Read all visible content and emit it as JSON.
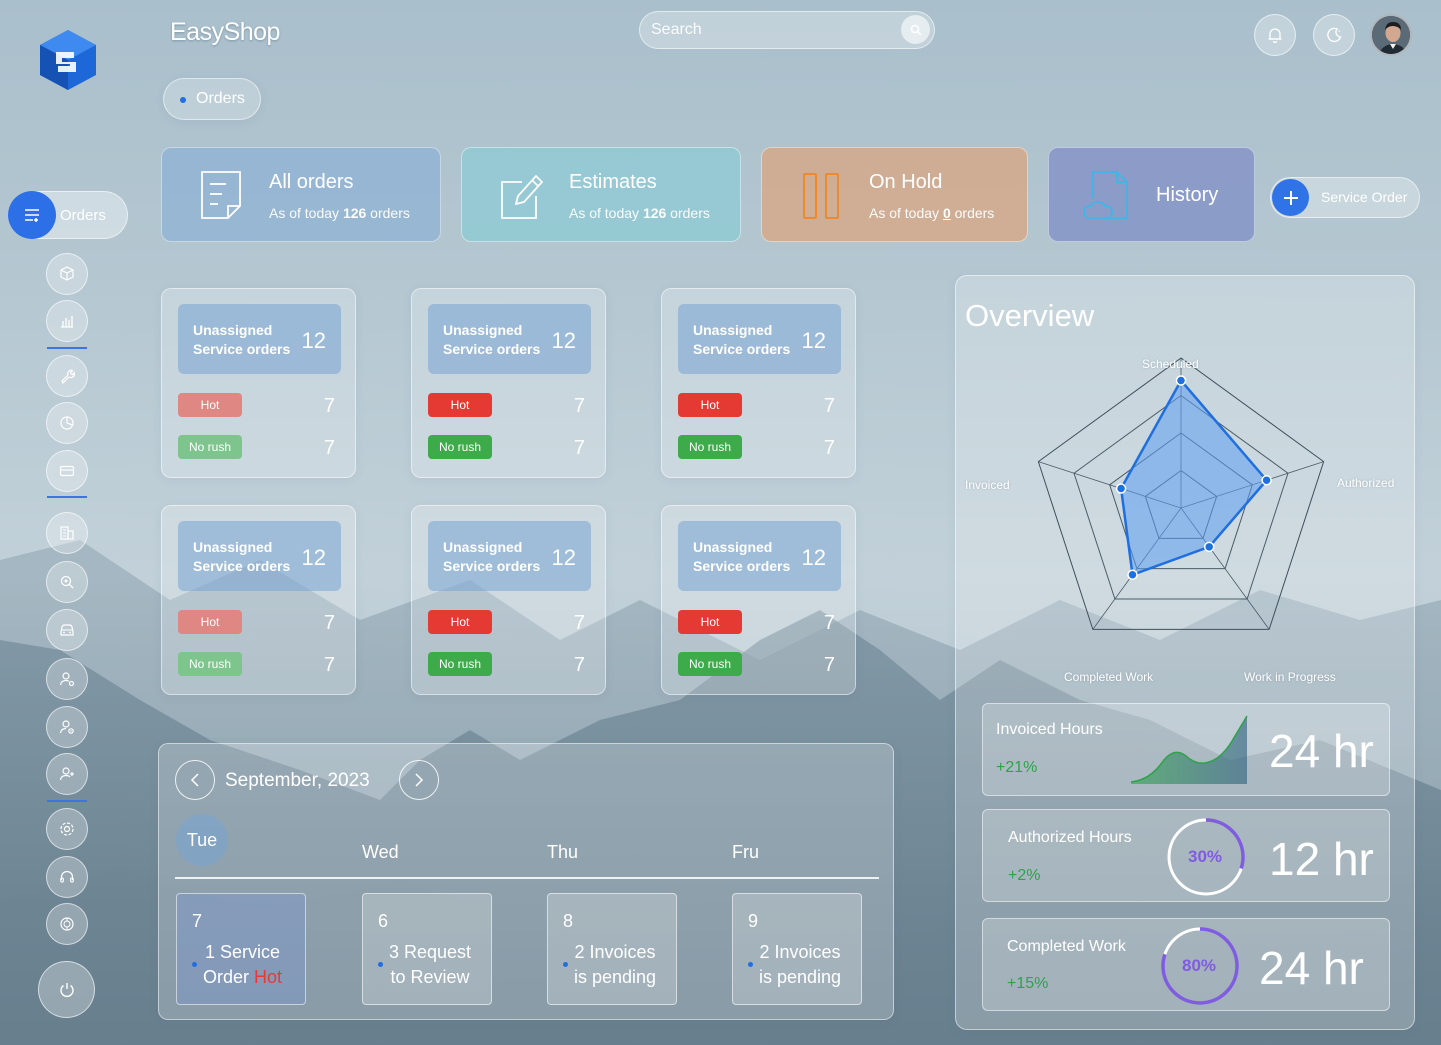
{
  "app": {
    "brand": "EasyShop"
  },
  "search": {
    "placeholder": "Search"
  },
  "header": {
    "icons": [
      "bell-icon",
      "theme-toggle-icon",
      "user-avatar"
    ]
  },
  "breadcrumb": {
    "label": "Orders"
  },
  "sidebar": {
    "active_label": "Orders",
    "items": [
      "box-icon",
      "chart-icon",
      "wrench-icon",
      "pie-chart-icon",
      "card-icon",
      "building-icon",
      "search-location-icon",
      "car-icon",
      "user-settings-icon",
      "user-gear-icon",
      "add-user-icon",
      "settings-icon",
      "headset-icon",
      "help-icon",
      "power-icon"
    ]
  },
  "top_cards": [
    {
      "title": "All orders",
      "sub_prefix": "As of today ",
      "count": "126",
      "sub_suffix": " orders",
      "color": "#8fb1d4"
    },
    {
      "title": "Estimates",
      "sub_prefix": "As of today ",
      "count": "126",
      "sub_suffix": " orders",
      "color": "#8ecad3"
    },
    {
      "title": "On Hold",
      "sub_prefix": "As of today ",
      "count": "0",
      "sub_suffix": " orders",
      "color": "#d6a888"
    },
    {
      "title": "History",
      "color": "#8492c6"
    }
  ],
  "service_order_button": {
    "label": "Service Order"
  },
  "order_cards": [
    {
      "title_line1": "Unassigned",
      "title_line2": "Service orders",
      "count": "12",
      "hot_label": "Hot",
      "hot_count": "7",
      "norush_label": "No rush",
      "norush_count": "7"
    },
    {
      "title_line1": "Unassigned",
      "title_line2": "Service orders",
      "count": "12",
      "hot_label": "Hot",
      "hot_count": "7",
      "norush_label": "No rush",
      "norush_count": "7"
    },
    {
      "title_line1": "Unassigned",
      "title_line2": "Service orders",
      "count": "12",
      "hot_label": "Hot",
      "hot_count": "7",
      "norush_label": "No rush",
      "norush_count": "7"
    },
    {
      "title_line1": "Unassigned",
      "title_line2": "Service orders",
      "count": "12",
      "hot_label": "Hot",
      "hot_count": "7",
      "norush_label": "No rush",
      "norush_count": "7"
    },
    {
      "title_line1": "Unassigned",
      "title_line2": "Service orders",
      "count": "12",
      "hot_label": "Hot",
      "hot_count": "7",
      "norush_label": "No rush",
      "norush_count": "7"
    },
    {
      "title_line1": "Unassigned",
      "title_line2": "Service orders",
      "count": "12",
      "hot_label": "Hot",
      "hot_count": "7",
      "norush_label": "No rush",
      "norush_count": "7"
    }
  ],
  "calendar": {
    "month": "September, 2023",
    "days": [
      "Tue",
      "Wed",
      "Thu",
      "Fru"
    ],
    "events": [
      {
        "date": "7",
        "line1": "1 Service",
        "line2": "Order",
        "hot": "Hot"
      },
      {
        "date": "6",
        "line1": "3 Request",
        "line2": "to Review"
      },
      {
        "date": "8",
        "line1": "2 Invoices",
        "line2": "is pending"
      },
      {
        "date": "9",
        "line1": "2 Invoices",
        "line2": "is pending"
      }
    ]
  },
  "overview": {
    "title": "Overview",
    "radar_axes": [
      "Scheduled",
      "Authorized",
      "Work in Progress",
      "Completed Work",
      "Invoiced"
    ],
    "radar_values": [
      0.85,
      0.6,
      0.32,
      0.55,
      0.42
    ],
    "stats": [
      {
        "name": "Invoiced Hours",
        "change": "+21%",
        "value": "24 hr"
      },
      {
        "name": "Authorized Hours",
        "change": "+2%",
        "value": "12 hr",
        "percent": "30%",
        "fraction": 0.3
      },
      {
        "name": "Completed Work",
        "change": "+15%",
        "value": "24 hr",
        "percent": "80%",
        "fraction": 0.8
      }
    ]
  },
  "colors": {
    "accent": "#2d6fe6",
    "hot": "#e53a33",
    "no_rush": "#3dab4a",
    "positive": "#2fa24b"
  }
}
